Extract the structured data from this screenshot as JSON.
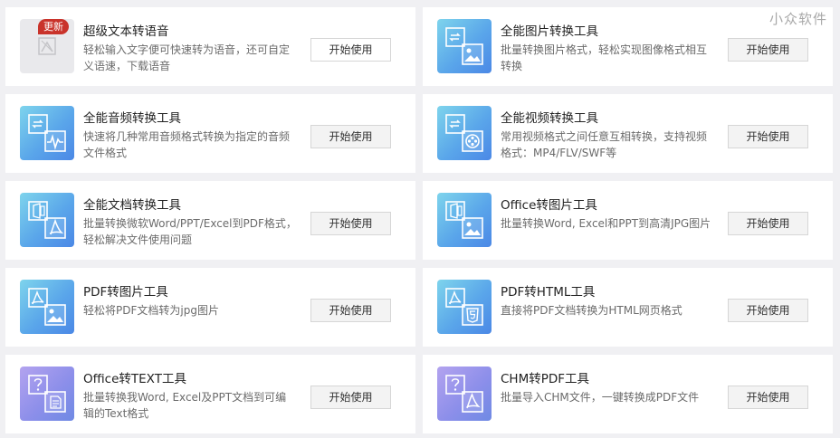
{
  "watermark": "小众软件",
  "tools": [
    {
      "title": "超级文本转语音",
      "desc": "轻松输入文字便可快速转为语音，还可自定义语速，下载语音",
      "button": "开始使用",
      "badge": "更新",
      "icon": "text-to-speech-icon"
    },
    {
      "title": "全能图片转换工具",
      "desc": "批量转换图片格式，轻松实现图像格式相互转换",
      "button": "开始使用",
      "icon": "image-convert-icon"
    },
    {
      "title": "全能音频转换工具",
      "desc": "快速将几种常用音频格式转换为指定的音频文件格式",
      "button": "开始使用",
      "icon": "audio-convert-icon"
    },
    {
      "title": "全能视频转换工具",
      "desc": "常用视频格式之间任意互相转换，支持视频格式：MP4/FLV/SWF等",
      "button": "开始使用",
      "icon": "video-convert-icon"
    },
    {
      "title": "全能文档转换工具",
      "desc": "批量转换微软Word/PPT/Excel到PDF格式，轻松解决文件使用问题",
      "button": "开始使用",
      "icon": "document-convert-icon"
    },
    {
      "title": "Office转图片工具",
      "desc": "批量转换Word, Excel和PPT到高清JPG图片",
      "button": "开始使用",
      "icon": "office-to-image-icon"
    },
    {
      "title": "PDF转图片工具",
      "desc": "轻松将PDF文档转为jpg图片",
      "button": "开始使用",
      "icon": "pdf-to-image-icon"
    },
    {
      "title": "PDF转HTML工具",
      "desc": "直接将PDF文档转换为HTML网页格式",
      "button": "开始使用",
      "icon": "pdf-to-html-icon"
    },
    {
      "title": "Office转TEXT工具",
      "desc": "批量转换我Word, Excel及PPT文档到可编辑的Text格式",
      "button": "开始使用",
      "icon": "office-to-text-icon"
    },
    {
      "title": "CHM转PDF工具",
      "desc": "批量导入CHM文件，一键转换成PDF文件",
      "button": "开始使用",
      "icon": "chm-to-pdf-icon"
    }
  ],
  "colors": {
    "background": "#f0f0f3",
    "icon_gradient_start": "#7ed4ec",
    "icon_gradient_end": "#4b88e6",
    "purple_gradient_start": "#b3a3ef",
    "badge": "#c9332b"
  }
}
